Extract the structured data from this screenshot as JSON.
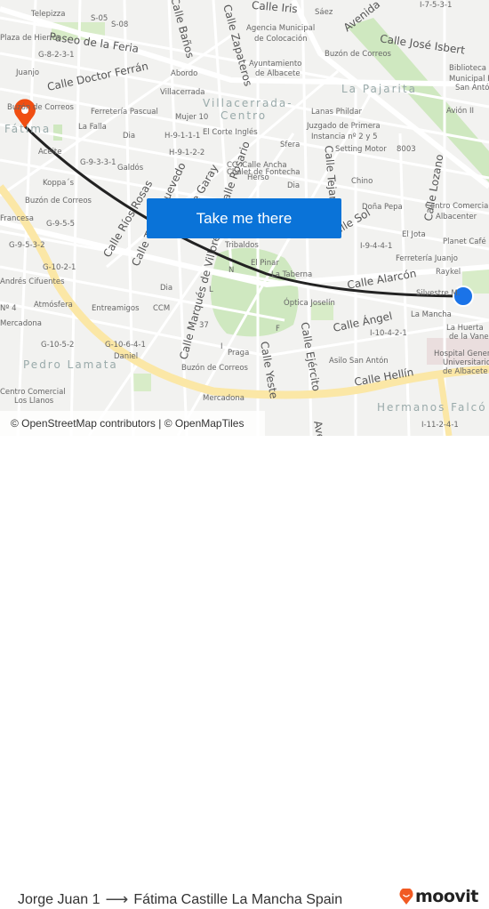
{
  "map": {
    "streets": [
      {
        "text": "Calle Iris"
      },
      {
        "text": "Avenida"
      },
      {
        "text": "Calle José Isbert"
      },
      {
        "text": "Paseo de la Feria"
      },
      {
        "text": "Calle Doctor Ferrán"
      },
      {
        "text": "Calle Baños"
      },
      {
        "text": "Calle Zapateros"
      },
      {
        "text": "Calle Ríos Rosas"
      },
      {
        "text": "Calle Torres Quevedo"
      },
      {
        "text": "Calle Garay"
      },
      {
        "text": "Calle Rosario"
      },
      {
        "text": "Calle Tejares"
      },
      {
        "text": "Calle Lozano"
      },
      {
        "text": "Calle Sol"
      },
      {
        "text": "Calle Alarcón"
      },
      {
        "text": "Calle Ángel"
      },
      {
        "text": "Calle Marqués de Villores"
      },
      {
        "text": "Calle Yeste"
      },
      {
        "text": "Calle Ejército"
      },
      {
        "text": "Calle Hellín"
      },
      {
        "text": "Calle Baños"
      },
      {
        "text": "Ave"
      }
    ],
    "districts": [
      {
        "text": "Fátima"
      },
      {
        "text": "La Pajarita"
      },
      {
        "text": "Villacerrada-"
      },
      {
        "text": "Centro"
      },
      {
        "text": "Pedro Lamata"
      },
      {
        "text": "Hermanos Falcó"
      }
    ],
    "pois": [
      "Telepizza",
      "S-05",
      "S-08",
      "Sáez",
      "Agencia Municipal",
      "de Colocación",
      "I-7-5-3-1",
      "Plaza de Hierros",
      "G-8-2-3-1",
      "Buzón de Correos",
      "Abordo",
      "Ayuntamiento",
      "de Albacete",
      "Biblioteca",
      "Municipal Polígono",
      "San Antón",
      "Juanjo",
      "Villacerrada",
      "Buzón de Correos",
      "Ferretería Pascual",
      "Mujer 10",
      "Lanas Phildar",
      "Avión II",
      "La Falla",
      "Dia",
      "H-9-1-1-1",
      "El Corte Inglés",
      "Juzgado de Primera",
      "Instancia nº 2 y 5",
      "Sfera",
      "Aceite",
      "H-9-1-2-2",
      "Setting Motor",
      "8003",
      "G-9-3-3-1",
      "Galdós",
      "CC. Calle Ancha",
      "Herso",
      "Dia",
      "Chino",
      "Koppa´s",
      "Chalet de Fontecha",
      "Buzón de Correos",
      "Doña Pepa",
      "Centro Comercial",
      "Albacenter",
      "Francesa",
      "G-9-5-5",
      "El Jota",
      "Planet Café",
      "G-9-5-3-2",
      "Tribaldos",
      "I-9-4-4-1",
      "Ferretería Juanjo",
      "G-10-2-1",
      "El Pinar",
      "La Taberna",
      "Raykel",
      "Andrés Cifuentes",
      "Silvestre M.",
      "Dia",
      "Atmósfera",
      "Entreamigos",
      "CCM",
      "Óptica Joselín",
      "La Mancha",
      "Mercadona",
      "37",
      "I-10-4-2-1",
      "La Huerta",
      "de la Vane",
      "G-10-5-2",
      "G-10-6-4-1",
      "Praga",
      "Hospital General",
      "Universitario",
      "de Albacete",
      "Daniel",
      "Buzón de Correos",
      "Asilo San Antón",
      "Centro Comercial",
      "Los Llanos",
      "Mercadona",
      "I-11-2-4-1",
      "N",
      "L",
      "I",
      "F",
      "Nº 4"
    ],
    "attribution": "© OpenStreetMap contributors | © OpenMapTiles",
    "origin_marker": {
      "name": "Jorge Juan 1",
      "color": "#1a73e8"
    },
    "destination_marker": {
      "name": "Fátima",
      "color": "#f04e12"
    },
    "route_color": "#222222"
  },
  "cta": {
    "label": "Take me there",
    "color": "#0a73d8"
  },
  "footer": {
    "origin": "Jorge Juan 1",
    "arrow": "⟶",
    "destination": "Fátima Castille La Mancha Spain",
    "brand": "moovit",
    "brand_color": "#f15a22"
  }
}
